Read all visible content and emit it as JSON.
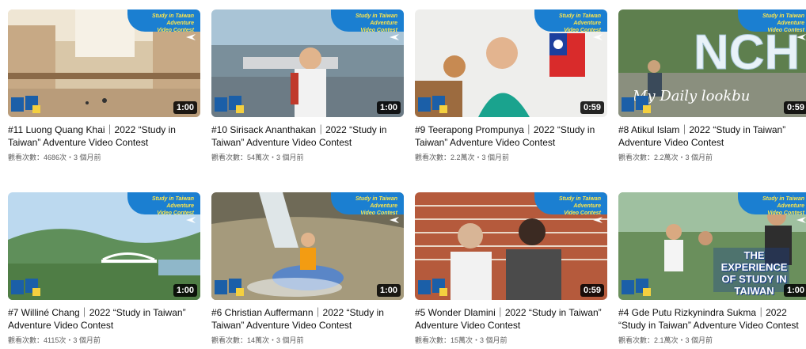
{
  "banner": {
    "text": "Study in Taiwan Adventure\nVideo Contest",
    "color": "#1b7fd1"
  },
  "videos": [
    {
      "title": "#11 Luong Quang Khai｜2022 “Study in Taiwan” Adventure Video Contest",
      "meta": "觀看次數：4686次・3 個月前",
      "duration": "1:00",
      "scene": "museum-hall"
    },
    {
      "title": "#10 Sirisack Ananthakan｜2022 “Study in Taiwan” Adventure Video Contest",
      "meta": "觀看次數：54萬次・3 個月前",
      "duration": "1:00",
      "scene": "harbor-walk"
    },
    {
      "title": "#9 Teerapong Prompunya｜2022 “Study in Taiwan” Adventure Video Contest",
      "meta": "觀看次數：2.2萬次・3 個月前",
      "duration": "0:59",
      "scene": "room-flag"
    },
    {
      "title": "#8 Atikul Islam｜2022 “Study in Taiwan” Adventure Video Contest",
      "meta": "觀看次數：2.2萬次・3 個月前",
      "duration": "0:59",
      "scene": "nchu-sign",
      "overlay_text": "My Daily lookbu"
    },
    {
      "title": "#7 Williné Chang｜2022 “Study in Taiwan” Adventure Video Contest",
      "meta": "觀看次數：4115次・3 個月前",
      "duration": "1:00",
      "scene": "bridge-landscape"
    },
    {
      "title": "#6 Christian Auffermann｜2022 “Study in Taiwan” Adventure Video Contest",
      "meta": "觀看次數：14萬次・3 個月前",
      "duration": "1:00",
      "scene": "river-tube"
    },
    {
      "title": "#5 Wonder Dlamini｜2022 “Study in Taiwan” Adventure Video Contest",
      "meta": "觀看次數：15萬次・3 個月前",
      "duration": "0:59",
      "scene": "brick-wall"
    },
    {
      "title": "#4 Gde Putu Rizkynindra Sukma｜2022 “Study in Taiwan” Adventure Video Contest",
      "meta": "觀看次數：2.1萬次・3 個月前",
      "duration": "1:00",
      "scene": "forest-friends",
      "overlay_text": "THE EXPERIENCE OF STUDY IN TAIWAN"
    }
  ]
}
